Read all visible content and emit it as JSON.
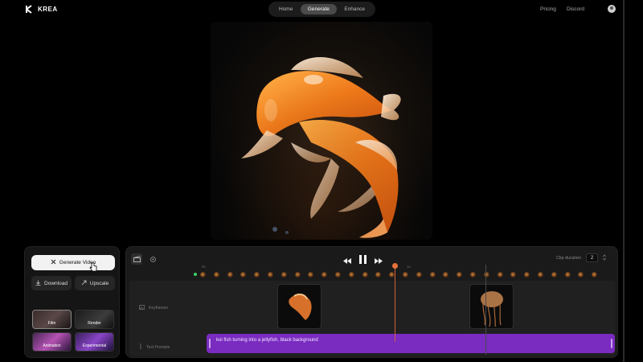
{
  "app": {
    "name": "KREA"
  },
  "nav": {
    "tabs": [
      {
        "label": "Home"
      },
      {
        "label": "Generate",
        "active": true
      },
      {
        "label": "Enhance"
      }
    ]
  },
  "header_links": {
    "pricing": "Pricing",
    "discord": "Discord"
  },
  "left_panel": {
    "generate_label": "Generate Video",
    "download_label": "Download",
    "upscale_label": "Upscale",
    "styles": [
      {
        "label": "Film",
        "selected": true
      },
      {
        "label": "Render"
      },
      {
        "label": "Animation"
      },
      {
        "label": "Experimental"
      }
    ]
  },
  "timeline": {
    "clip_duration_label": "Clip duration",
    "clip_duration_value": "2",
    "ruler": {
      "start": "0s",
      "mid": "1s"
    },
    "tracks": {
      "keyframes": "Keyframes",
      "text_prompts": "Text Prompts"
    },
    "prompt_text": "koi fish turning into a jellyfish, black background"
  },
  "colors": {
    "accent": "#7a2bc0",
    "playhead": "#e8703a"
  }
}
